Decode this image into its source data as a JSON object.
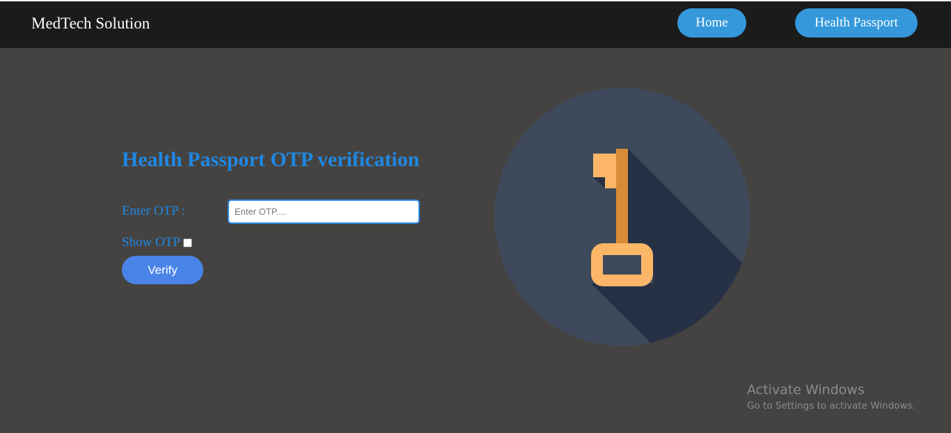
{
  "navbar": {
    "brand": "MedTech Solution",
    "home_label": "Home",
    "passport_label": "Health Passport"
  },
  "form": {
    "title": "Health Passport OTP verification",
    "otp_label": "Enter OTP :",
    "otp_placeholder": "Enter OTP....",
    "otp_value": "",
    "show_otp_label": "Show OTP",
    "show_otp_checked": false,
    "verify_label": "Verify"
  },
  "illustration": {
    "icon": "key-icon",
    "colors": {
      "circle": "#3e4a5b",
      "shadow": "#263145",
      "key_light": "#fbb767",
      "key_dark": "#d98c35"
    }
  },
  "watermark": {
    "title": "Activate Windows",
    "subtitle": "Go to Settings to activate Windows."
  },
  "colors": {
    "page_bg": "#454341",
    "navbar_bg": "#1b1b1b",
    "nav_button": "#3498db",
    "accent_text": "#1e88e5",
    "verify_button": "#4a84e8"
  }
}
